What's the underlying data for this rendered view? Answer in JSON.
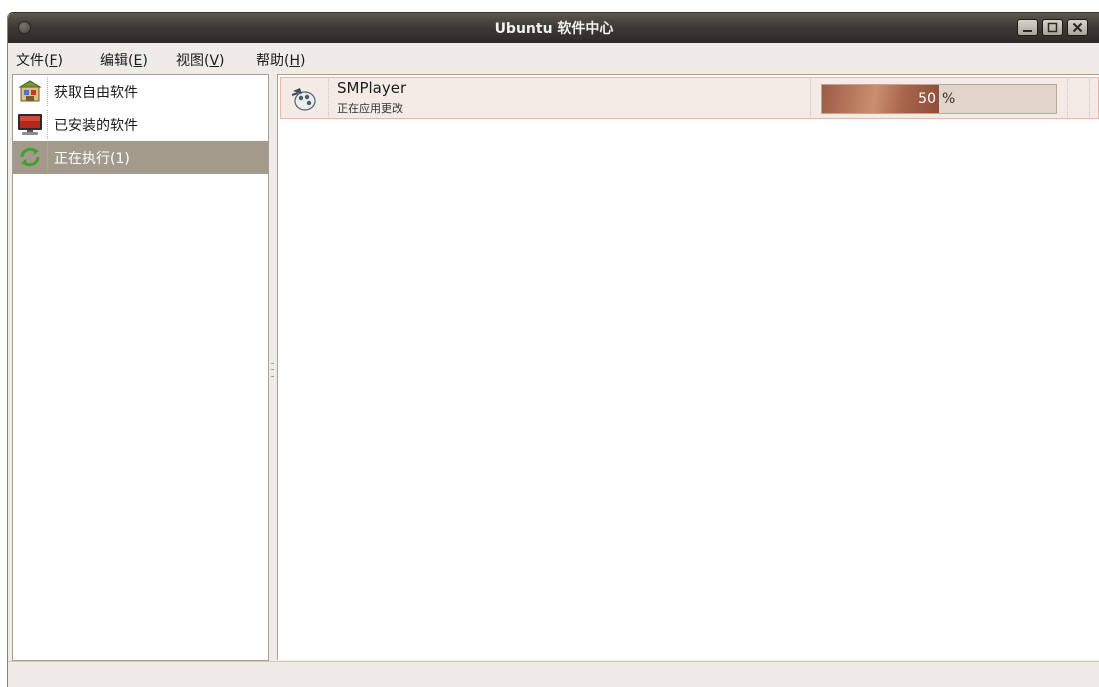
{
  "window": {
    "title": "Ubuntu 软件中心"
  },
  "menubar": {
    "items": [
      {
        "label": "文件(",
        "mnemonic": "F",
        "suffix": ")"
      },
      {
        "label": "编辑(",
        "mnemonic": "E",
        "suffix": ")"
      },
      {
        "label": "视图(",
        "mnemonic": "V",
        "suffix": ")"
      },
      {
        "label": "帮助(",
        "mnemonic": "H",
        "suffix": ")"
      }
    ]
  },
  "sidebar": {
    "items": [
      {
        "label": "获取自由软件",
        "icon": "software-store-icon",
        "selected": false
      },
      {
        "label": "已安装的软件",
        "icon": "computer-monitor-icon",
        "selected": false
      },
      {
        "label": "正在执行(1)",
        "icon": "refresh-arrows-icon",
        "selected": true
      }
    ]
  },
  "main": {
    "job": {
      "name": "SMPlayer",
      "status": "正在应用更改",
      "icon": "smplayer-icon",
      "progress_value": "50",
      "progress_unit": "%",
      "progress_fraction": 0.5
    }
  },
  "colors": {
    "titlebar": "#3c3833",
    "selection": "#a49a8c",
    "progress_fill": "#a6644a",
    "job_row_bg": "#f4ebe6"
  }
}
